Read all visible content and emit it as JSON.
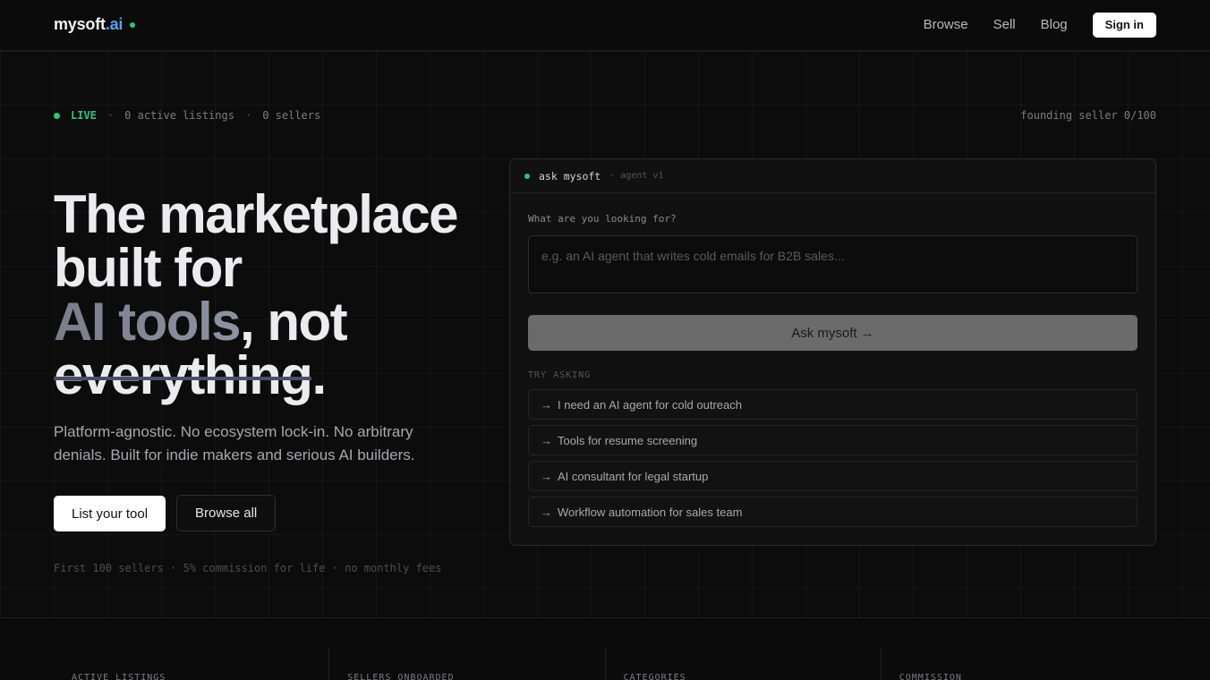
{
  "header": {
    "logo_main": "mysoft",
    "logo_accent": ".ai",
    "nav": [
      "Browse",
      "Sell",
      "Blog"
    ],
    "signin_label": "Sign in"
  },
  "status": {
    "live_label": "LIVE",
    "listings": "0 active listings",
    "sellers": "0 sellers",
    "sep": "·",
    "founding": "founding seller 0/100"
  },
  "hero": {
    "line1": "The marketplace",
    "line2": "built for",
    "highlight": "AI tools",
    "not_text": ", not",
    "struck": "everything",
    "period": ".",
    "subtext": "Platform-agnostic. No ecosystem lock-in. No arbitrary denials. Built for indie makers and serious AI builders.",
    "primary_cta": "List your tool",
    "secondary_cta": "Browse all",
    "fine_print": "First 100 sellers · 5% commission for life · no monthly fees"
  },
  "agent": {
    "title": "ask mysoft",
    "version": "· agent v1",
    "question_label": "What are you looking for?",
    "input_value": "",
    "input_placeholder": "e.g. an AI agent that writes cold emails for B2B sales...",
    "ask_button": "Ask mysoft →",
    "try_label": "TRY ASKING",
    "suggestions": [
      "I need an AI agent for cold outreach",
      "Tools for resume screening",
      "AI consultant for legal startup",
      "Workflow automation for sales team"
    ],
    "suggestion_arrow": "→"
  },
  "stats": [
    "ACTIVE LISTINGS",
    "SELLERS ONBOARDED",
    "CATEGORIES",
    "COMMISSION"
  ],
  "colors": {
    "background": "#0b0b0b",
    "accent_green": "#34c27a",
    "logo_blue": "#5aa2f0"
  }
}
